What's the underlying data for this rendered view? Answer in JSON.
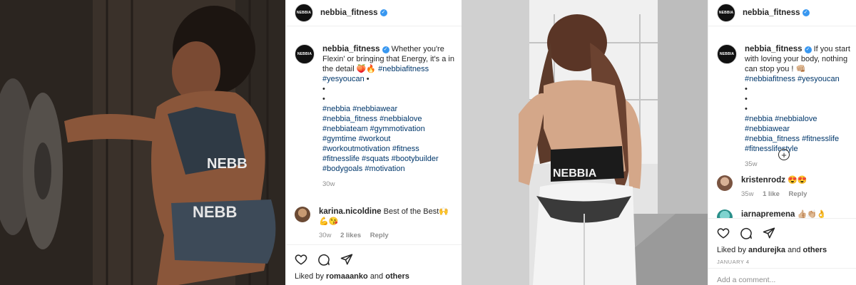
{
  "post1": {
    "username": "nebbia_fitness",
    "caption": {
      "text": "Whether you're Flexin' or bringing that Energy, it's a in the detail 🍑🔥",
      "tags1": "#nebbiafitness #yesyoucan",
      "bullet": "•",
      "dot": "•",
      "tag_lines": [
        "#nebbia #nebbiawear",
        "#nebbia_fitness #nebbialove",
        "#nebbiateam #gymmotivation",
        "#gymtime #workout",
        "#workoutmotivation #fitness",
        "#fitnesslife #squats #bootybuilder",
        "#bodygoals #motivation"
      ],
      "time": "30w"
    },
    "comment": {
      "user": "karina.nicoldine",
      "text": "Best of the Best🙌💪😘",
      "time": "30w",
      "likes": "2 likes",
      "reply": "Reply"
    },
    "liked_by": {
      "prefix": "Liked by",
      "user": "romaaanko",
      "and": "and",
      "others": "others"
    },
    "colors": {
      "verified": "#3897f0",
      "tag": "#00376b"
    }
  },
  "post2": {
    "username": "nebbia_fitness",
    "caption": {
      "text": "If you start with loving your body, nothing can stop you ! 👊🏼",
      "tags1": "#nebbiafitness #yesyoucan",
      "dots": [
        "•",
        "•",
        "•"
      ],
      "tag_lines": [
        "#nebbia #nebbialove #nebbiawear",
        "#nebbia_fitness #fitnesslife",
        "#fitnesslifestyle"
      ],
      "time": "35w"
    },
    "load_more": "⊕",
    "comment1": {
      "user": "kristenrodz",
      "text": "😍😍",
      "time": "35w",
      "likes": "1 like",
      "reply": "Reply"
    },
    "comment2": {
      "user": "iarnapremena",
      "text": "👍🏼👏🏼👌"
    },
    "liked_by": {
      "prefix": "Liked by",
      "user": "andurejka",
      "and": "and",
      "others": "others"
    },
    "date": "JANUARY 4",
    "add_comment": "Add a comment..."
  },
  "icons": [
    "heart-icon",
    "comment-icon",
    "share-icon"
  ]
}
